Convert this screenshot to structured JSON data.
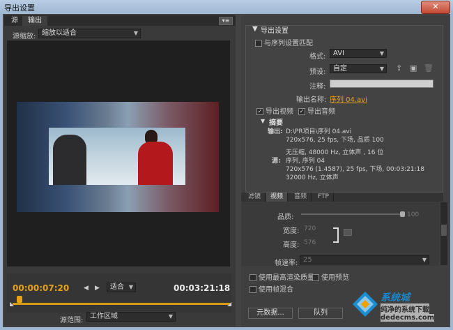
{
  "window": {
    "title": "导出设置",
    "close_label": "✕"
  },
  "left": {
    "tabs": [
      "源",
      "输出"
    ],
    "scale_label": "源缩放:",
    "scale_value": "缩放以适合",
    "timecode_current": "00:00:07:20",
    "timecode_duration": "00:03:21:18",
    "fit_value": "适合",
    "range_label": "源范围:",
    "range_value": "工作区域"
  },
  "export": {
    "section_title": "导出设置",
    "match_sequence": "与序列设置匹配",
    "format_label": "格式:",
    "format_value": "AVI",
    "preset_label": "预设:",
    "preset_value": "自定",
    "comment_label": "注释:",
    "output_name_label": "输出名称:",
    "output_name_value": "序列 04.avi",
    "export_video": "导出视频",
    "export_audio": "导出音频",
    "summary_title": "摘要",
    "output_label": "输出:",
    "output_lines": [
      "D:\\PR项目\\序列 04.avi",
      "720x576, 25 fps, 下场, 品质 100",
      "",
      "无压缩, 48000 Hz, 立体声 , 16 位"
    ],
    "source_label": "源:",
    "source_lines": [
      "序列, 序列 04",
      "720x576 (1.4587), 25 fps, 下场, 00:03:21:18",
      "32000 Hz, 立体声"
    ]
  },
  "tabs2": [
    "滤镜",
    "视频",
    "音频",
    "FTP"
  ],
  "video": {
    "quality_label": "品质:",
    "quality_value": "100",
    "width_label": "宽度:",
    "width_value": "720",
    "height_label": "高度:",
    "height_value": "576",
    "framerate_label": "帧速率:",
    "framerate_value": "25"
  },
  "options": {
    "max_render": "使用最高渲染质量",
    "use_preview": "使用预览",
    "frame_blend": "使用帧混合"
  },
  "buttons": {
    "metadata": "元数据...",
    "queue": "队列"
  },
  "watermark": {
    "brand": "系统城",
    "sub": "纯净的系统下载",
    "url": "dedecms.com"
  }
}
